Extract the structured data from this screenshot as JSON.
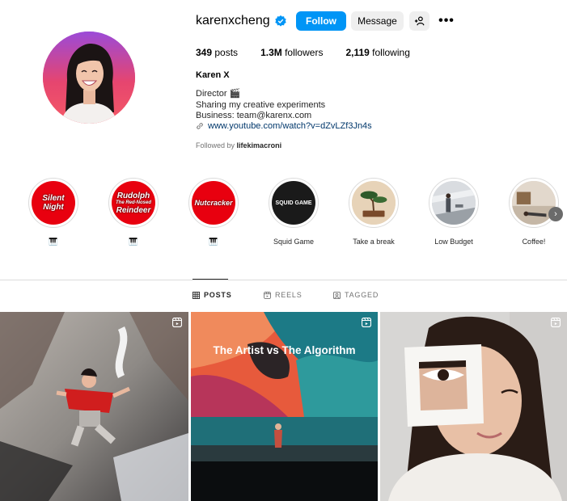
{
  "profile": {
    "username": "karenxcheng",
    "verified": true,
    "full_name": "Karen X",
    "bio_lines": [
      "Director 🎬",
      "Sharing my creative experiments",
      "Business: team@karenx.com"
    ],
    "link": "www.youtube.com/watch?v=dZvLZf3Jn4s",
    "followed_by_prefix": "Followed by",
    "followed_by_user": "lifekimacroni"
  },
  "actions": {
    "follow": "Follow",
    "message": "Message",
    "more": "•••"
  },
  "stats": {
    "posts_count": "349",
    "posts_label": "posts",
    "followers_count": "1.3M",
    "followers_label": "followers",
    "following_count": "2,119",
    "following_label": "following"
  },
  "highlights": [
    {
      "cover_text": "Silent Night",
      "label": "🎹",
      "color": "#e8000f"
    },
    {
      "cover_text": "Rudolph",
      "cover_subtext": "The Red-Nosed",
      "cover_text2": "Reindeer",
      "label": "🎹",
      "color": "#e8000f"
    },
    {
      "cover_text": "Nutcracker",
      "label": "🎹",
      "color": "#e8000f"
    },
    {
      "cover_text": "SQUID GAME",
      "label": "Squid Game",
      "color": "#1a1a1a"
    },
    {
      "label": "Take a break"
    },
    {
      "label": "Low Budget"
    },
    {
      "label": "Coffee!"
    }
  ],
  "tabs": [
    {
      "label": "POSTS",
      "active": true
    },
    {
      "label": "REELS",
      "active": false
    },
    {
      "label": "TAGGED",
      "active": false
    }
  ],
  "posts": [
    {
      "caption": ""
    },
    {
      "caption": "The Artist vs The Algorithm"
    },
    {
      "caption": ""
    }
  ],
  "colors": {
    "accent": "#0095f6",
    "link": "#00376b",
    "verified": "#0095f6"
  }
}
